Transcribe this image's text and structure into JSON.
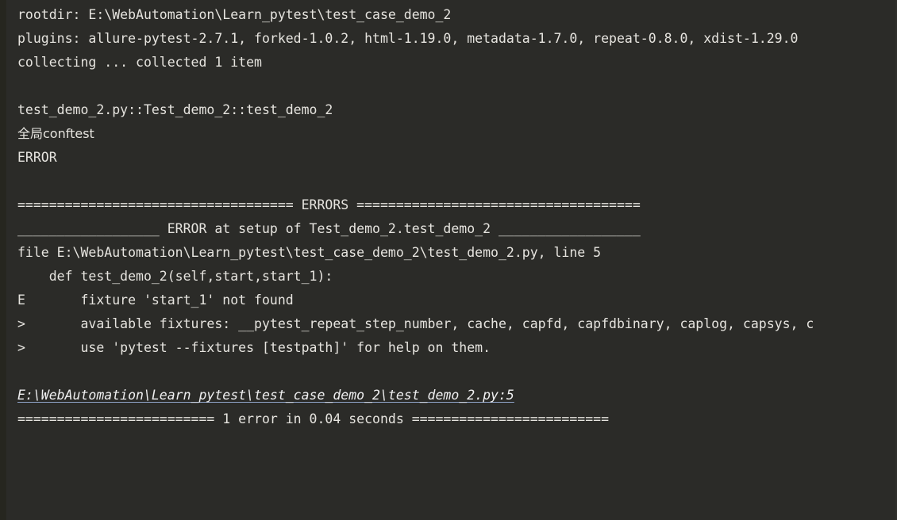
{
  "terminal": {
    "title": "pytest console output",
    "background_color": "#2b2b28",
    "text_color": "#e6e4df",
    "link_color": "#efeff0",
    "link_underline_color": "#8ea2c6",
    "lines": [
      {
        "id": "rootdir",
        "text": "rootdir: E:\\WebAutomation\\Learn_pytest\\test_case_demo_2",
        "style": "plain"
      },
      {
        "id": "plugins",
        "text": "plugins: allure-pytest-2.7.1, forked-1.0.2, html-1.19.0, metadata-1.7.0, repeat-0.8.0, xdist-1.29.0",
        "style": "plain"
      },
      {
        "id": "collecting",
        "text": "collecting ... collected 1 item",
        "style": "plain"
      },
      {
        "id": "blank-1",
        "text": "",
        "style": "blank"
      },
      {
        "id": "test-node-id",
        "text": "test_demo_2.py::Test_demo_2::test_demo_2",
        "style": "plain"
      },
      {
        "id": "conftest-print",
        "text": "全局conftest",
        "style": "cjk"
      },
      {
        "id": "error-status",
        "text": "ERROR",
        "style": "plain"
      },
      {
        "id": "blank-2",
        "text": "",
        "style": "blank"
      },
      {
        "id": "errors-banner",
        "text": "=================================== ERRORS ====================================",
        "style": "plain"
      },
      {
        "id": "error-at-setup-banner",
        "text": "__________________ ERROR at setup of Test_demo_2.test_demo_2 __________________",
        "style": "plain"
      },
      {
        "id": "file-location",
        "text": "file E:\\WebAutomation\\Learn_pytest\\test_case_demo_2\\test_demo_2.py, line 5",
        "style": "plain"
      },
      {
        "id": "def-signature",
        "text": "    def test_demo_2(self,start,start_1):",
        "style": "plain"
      },
      {
        "id": "fixture-not-found",
        "text": "E       fixture 'start_1' not found",
        "style": "plain"
      },
      {
        "id": "available-fixtures",
        "text": ">       available fixtures: __pytest_repeat_step_number, cache, capfd, capfdbinary, caplog, capsys, c",
        "style": "clip"
      },
      {
        "id": "use-pytest-fixtures-help",
        "text": ">       use 'pytest --fixtures [testpath]' for help on them.",
        "style": "plain"
      },
      {
        "id": "blank-3",
        "text": "",
        "style": "blank"
      },
      {
        "id": "source-link",
        "text": "E:\\WebAutomation\\Learn_pytest\\test_case_demo_2\\test_demo_2.py:5",
        "style": "link"
      },
      {
        "id": "summary-banner",
        "text": "========================= 1 error in 0.04 seconds =========================",
        "style": "plain"
      }
    ]
  }
}
